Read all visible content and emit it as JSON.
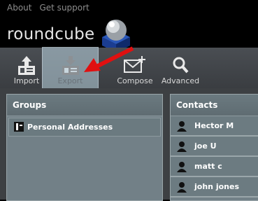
{
  "toplinks": {
    "about": "About",
    "support": "Get support"
  },
  "logo": {
    "text": "roundcube"
  },
  "toolbar": {
    "import_label": "Import",
    "export_label": "Export",
    "compose_label": "Compose",
    "advanced_label": "Advanced"
  },
  "groups": {
    "title": "Groups",
    "items": [
      {
        "label": "Personal Addresses"
      }
    ]
  },
  "contacts": {
    "title": "Contacts",
    "items": [
      {
        "name": "Hector M"
      },
      {
        "name": "joe U"
      },
      {
        "name": "matt c"
      },
      {
        "name": "john jones"
      }
    ]
  },
  "colors": {
    "highlight": "#bed7e4",
    "arrow": "#e01010",
    "panel": "#728087"
  }
}
